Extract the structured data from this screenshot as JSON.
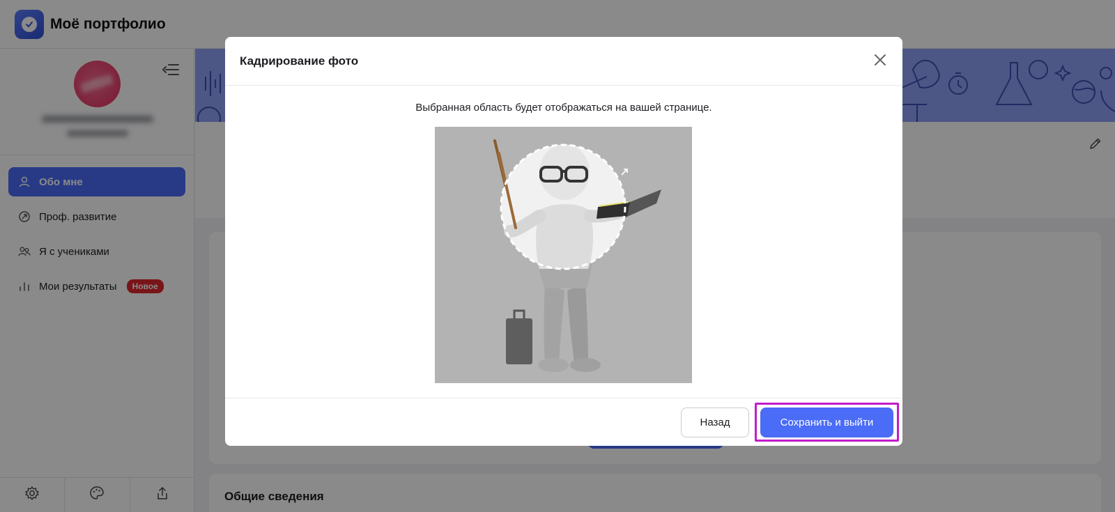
{
  "app": {
    "title": "Моё портфолио"
  },
  "sidebar": {
    "items": [
      {
        "label": "Обо мне",
        "icon": "user-icon",
        "active": true
      },
      {
        "label": "Проф. развитие",
        "icon": "growth-icon"
      },
      {
        "label": "Я с учениками",
        "icon": "users-icon"
      },
      {
        "label": "Мои результаты",
        "icon": "chart-icon",
        "badge": "Новое"
      }
    ],
    "footer_icons": [
      "settings-icon",
      "palette-icon",
      "share-icon"
    ]
  },
  "main": {
    "section_title": "Общие сведения"
  },
  "modal": {
    "title": "Кадрирование фото",
    "hint": "Выбранная область будет отображаться на вашей странице.",
    "back_label": "Назад",
    "save_label": "Сохранить и выйти"
  },
  "colors": {
    "accent": "#4a6cf7",
    "badge": "#e0252e",
    "highlight": "#c21bc9",
    "banner": "#8fa2f5"
  }
}
